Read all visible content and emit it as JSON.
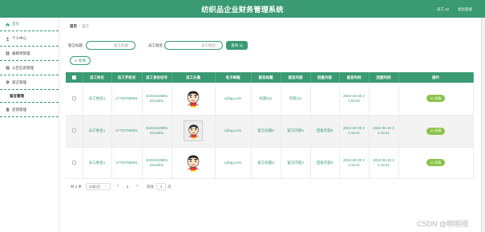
{
  "app": {
    "title": "纺织品企业财务管理系统",
    "user": "员工 a1",
    "logout": "退出登录"
  },
  "colors": {
    "primary": "#3a9a73",
    "detail_button": "#8bc34a",
    "row_alt": "#f3f3f3"
  },
  "sidebar": {
    "items": [
      {
        "label": "首页",
        "icon": "home-icon"
      },
      {
        "label": "个人中心",
        "icon": "user-icon"
      },
      {
        "label": "报销项管理",
        "icon": "grid-icon"
      },
      {
        "label": "公告信息管理",
        "icon": "list-icon"
      },
      {
        "label": "留言管理",
        "icon": "pin-icon",
        "expanded": true,
        "children": [
          {
            "label": "留言管理"
          }
        ]
      },
      {
        "label": "反馈管理",
        "icon": "document-icon"
      }
    ]
  },
  "breadcrumb": {
    "home": "首页",
    "separator": "/",
    "current": "留言"
  },
  "search": {
    "title_label": "留言标题",
    "title_placeholder": "留言标题",
    "name_label": "员工姓名",
    "name_placeholder": "员工姓名",
    "button": "查询"
  },
  "toolbar": {
    "add": "新增"
  },
  "table": {
    "columns": [
      "员工姓名",
      "员工手机号",
      "员工身份证号",
      "员工头像",
      "电子邮箱",
      "留言标题",
      "留言内容",
      "回复内容",
      "留言时间",
      "回复时间",
      "操作"
    ],
    "rows": [
      {
        "name": "员工姓名1",
        "phone": "17703786901",
        "id_card": "410224199010212001",
        "avatar": "cartoon-avatar",
        "email": "1@qq.com",
        "title": "标题111",
        "content": "内容111",
        "reply": "",
        "created": "2022-02-20 21:53:54",
        "replied": "",
        "action": "详情"
      },
      {
        "name": "员工姓名1",
        "phone": "17703786901",
        "id_card": "410224199010212001",
        "avatar": "cartoon-avatar",
        "email": "1@qq.com",
        "title": "留言标题8",
        "content": "留言内容8",
        "reply": "回复内容8",
        "created": "2022-02-20 21:16:41",
        "replied": "2022-02-20 21:16:41",
        "action": "详情"
      },
      {
        "name": "员工姓名1",
        "phone": "17703786901",
        "id_card": "410224199010212001",
        "avatar": "cartoon-avatar",
        "email": "1@qq.com",
        "title": "留言标题3",
        "content": "留言内容3",
        "reply": "回复内容3",
        "created": "2022-02-20 21:16:41",
        "replied": "2022-02-20 21:16:41",
        "action": "详情"
      }
    ]
  },
  "pagination": {
    "total": "共 3 条",
    "page_size": "10条/页",
    "prev": "<",
    "current": "1",
    "next": ">",
    "goto_label": "前往",
    "goto_value": "1",
    "goto_suffix": "页"
  },
  "watermark": "CSDN @明明视"
}
